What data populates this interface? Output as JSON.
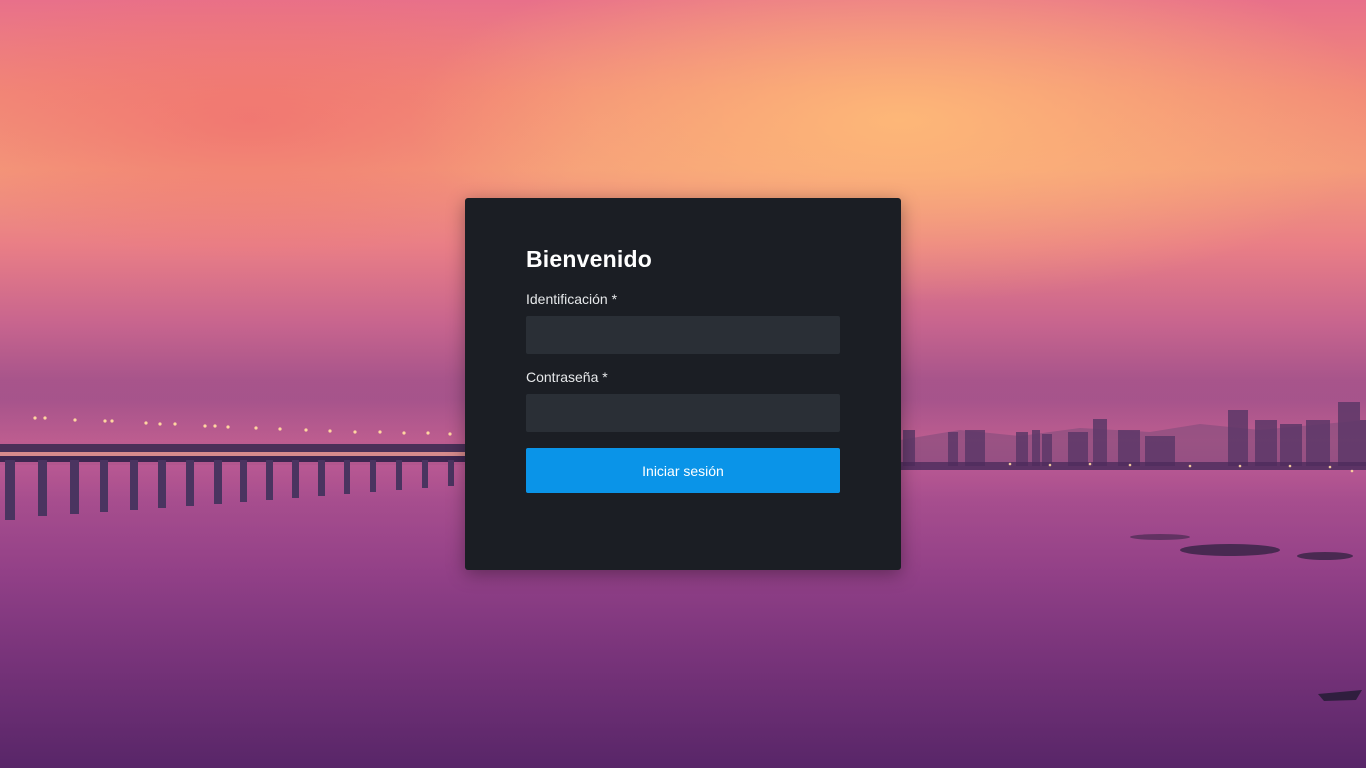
{
  "login": {
    "title": "Bienvenido",
    "id_label": "Identificación *",
    "id_value": "",
    "password_label": "Contraseña *",
    "password_value": "",
    "submit_label": "Iniciar sesión"
  },
  "colors": {
    "card_background": "#1b1e24",
    "input_background": "#2a2f36",
    "button_primary": "#0a94e8"
  },
  "background": {
    "scene": "sunset-bay-with-bridge-and-skyline"
  }
}
